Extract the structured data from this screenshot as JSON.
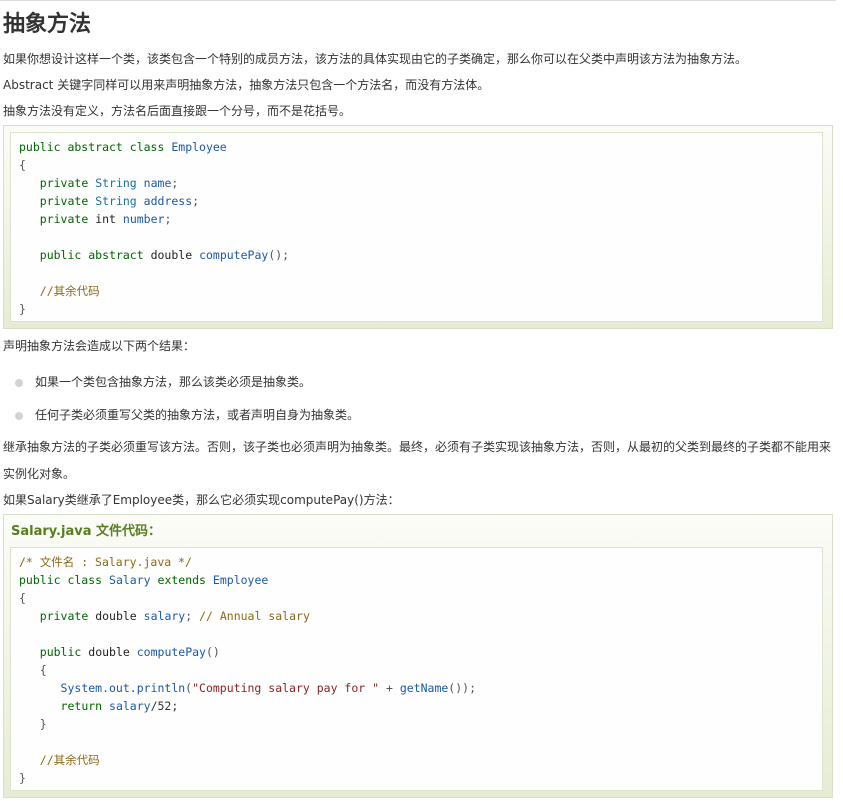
{
  "heading": "抽象方法",
  "intro": [
    "如果你想设计这样一个类，该类包含一个特别的成员方法，该方法的具体实现由它的子类确定，那么你可以在父类中声明该方法为抽象方法。",
    "Abstract 关键字同样可以用来声明抽象方法，抽象方法只包含一个方法名，而没有方法体。",
    "抽象方法没有定义，方法名后面直接跟一个分号，而不是花括号。"
  ],
  "code1": {
    "line1": {
      "kw": "public abstract class",
      "name": "Employee"
    },
    "open_brace": "{",
    "fields": [
      {
        "mod": "private",
        "type": "String",
        "name": "name",
        "end": ";"
      },
      {
        "mod": "private",
        "type": "String",
        "name": "address",
        "end": ";"
      },
      {
        "mod": "private",
        "type": "int",
        "name": "number",
        "end": ";"
      }
    ],
    "method": {
      "mod": "public abstract",
      "type": "double",
      "name": "computePay",
      "end": "();"
    },
    "comment": "//其余代码",
    "close_brace": "}"
  },
  "result_intro": "声明抽象方法会造成以下两个结果：",
  "bullets": [
    "如果一个类包含抽象方法，那么该类必须是抽象类。",
    "任何子类必须重写父类的抽象方法，或者声明自身为抽象类。"
  ],
  "inherit_para": "继承抽象方法的子类必须重写该方法。否则，该子类也必须声明为抽象类。最终，必须有子类实现该抽象方法，否则，从最初的父类到最终的子类都不能用来实例化对象。",
  "salary_intro": "如果Salary类继承了Employee类，那么它必须实现computePay()方法：",
  "example2": {
    "title": "Salary.java 文件代码：",
    "file_comment": "/* 文件名 : Salary.java */",
    "class_line": {
      "kw": "public class",
      "name": "Salary",
      "ext": "extends",
      "parent": "Employee"
    },
    "open_brace": "{",
    "field": {
      "mod": "private",
      "type": "double",
      "name": "salary",
      "semi": ";",
      "comment": "// Annual salary"
    },
    "method": {
      "mod": "public",
      "type": "double",
      "name": "computePay",
      "paren": "()"
    },
    "m_open": "{",
    "println": {
      "obj": "System.out.println",
      "str": "\"Computing salary pay for \"",
      "plus": " + ",
      "call": "getName",
      "end": "());"
    },
    "ret": {
      "kw": "return",
      "expr": "salary",
      "rest": "/52;"
    },
    "m_close": "}",
    "comment": "//其余代码",
    "close_brace": "}"
  }
}
